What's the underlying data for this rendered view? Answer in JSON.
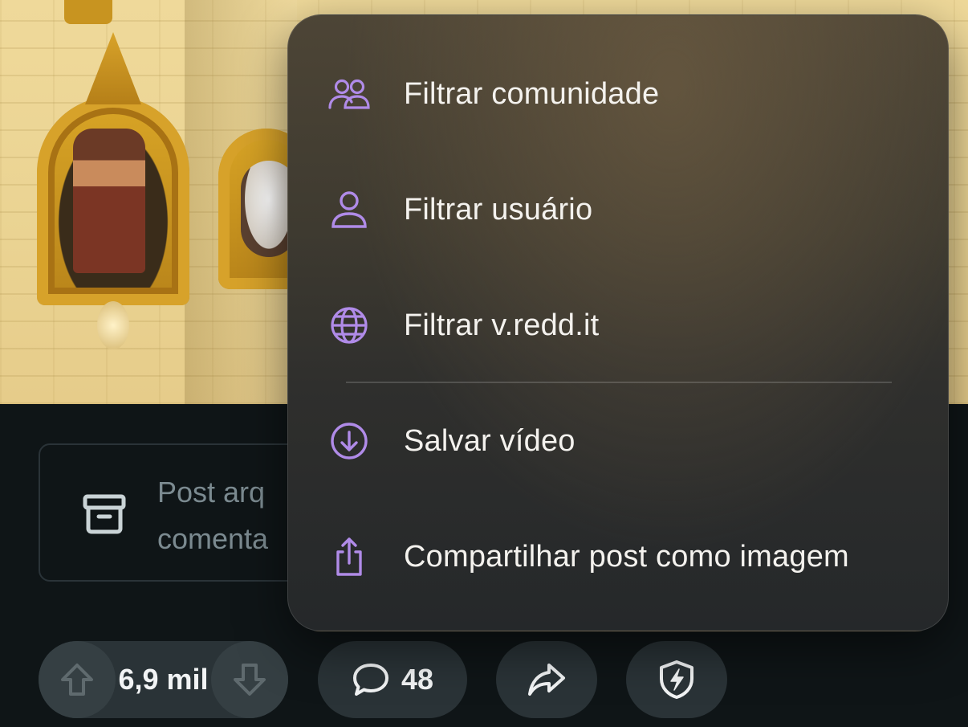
{
  "post": {
    "archived_notice": "Post arq\ncomenta"
  },
  "actions": {
    "score": "6,9 mil",
    "comments_count": "48"
  },
  "menu": {
    "items": [
      {
        "label": "Filtrar comunidade",
        "icon": "community-icon"
      },
      {
        "label": "Filtrar usuário",
        "icon": "user-icon"
      },
      {
        "label": "Filtrar v.redd.it",
        "icon": "globe-icon"
      },
      {
        "label": "Salvar vídeo",
        "icon": "download-icon"
      },
      {
        "label": "Compartilhar post como imagem",
        "icon": "share-image-icon"
      }
    ]
  },
  "colors": {
    "accent": "#b08be8",
    "background": "#0f1517",
    "pill": "#2a3337"
  }
}
